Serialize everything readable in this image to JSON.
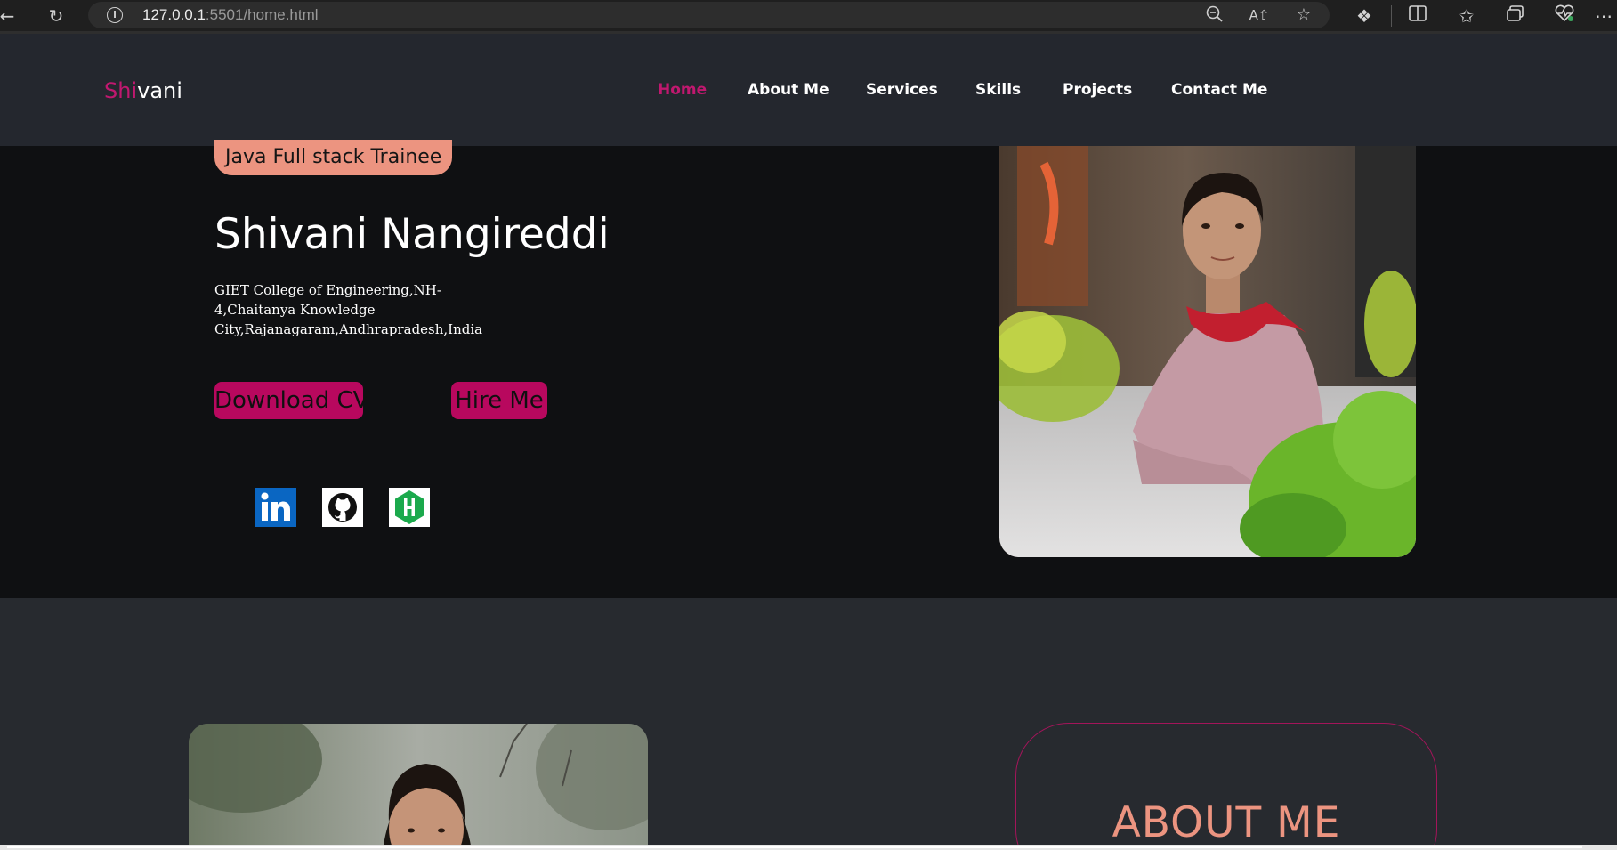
{
  "browser": {
    "url_host": "127.0.0.1",
    "url_rest": ":5501/home.html"
  },
  "site": {
    "logo_accent": "Shi",
    "logo_rest": "vani",
    "accent_color": "#c0186f",
    "nav": [
      {
        "label": "Home",
        "active": true
      },
      {
        "label": "About Me",
        "active": false
      },
      {
        "label": "Services",
        "active": false
      },
      {
        "label": "Skills",
        "active": false
      },
      {
        "label": "Projects",
        "active": false
      },
      {
        "label": "Contact Me",
        "active": false
      }
    ]
  },
  "hero": {
    "badge": "Java Full stack Trainee",
    "name": "Shivani Nangireddi",
    "address_lines": [
      "GIET College of Engineering,NH-",
      "4,Chaitanya Knowledge",
      "City,Rajanagaram,Andhrapradesh,India"
    ],
    "download_label": "Download CV",
    "hire_label": "Hire Me",
    "social": [
      "linkedin-icon",
      "github-icon",
      "hackerrank-icon"
    ]
  },
  "about": {
    "title": "ABOUT ME"
  }
}
